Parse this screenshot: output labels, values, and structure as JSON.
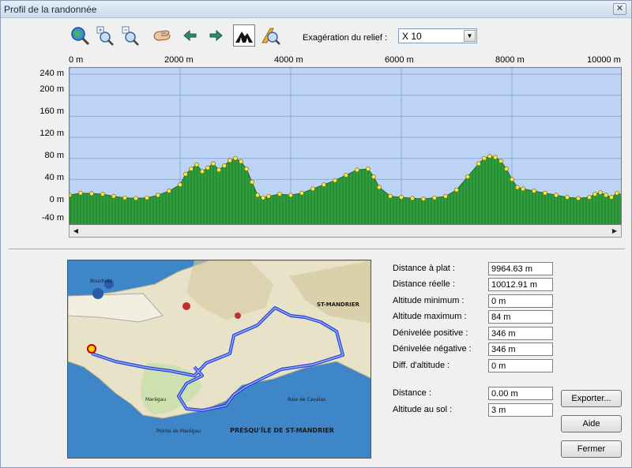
{
  "window": {
    "title": "Profil de la randonnée",
    "close_glyph": "✕"
  },
  "toolbar": {
    "buttons": [
      {
        "name": "zoom-extent-icon"
      },
      {
        "name": "zoom-in-icon"
      },
      {
        "name": "zoom-out-icon"
      },
      {
        "name": "pan-hand-icon"
      },
      {
        "name": "arrow-left-icon"
      },
      {
        "name": "arrow-right-icon"
      },
      {
        "name": "terrain-fill-icon",
        "active": true
      },
      {
        "name": "profile-search-icon"
      }
    ],
    "exaggeration_label": "Exagération du relief :",
    "exaggeration_value": "X 10"
  },
  "chart_data": {
    "type": "area",
    "xlabel": "",
    "ylabel": "",
    "xlim": [
      0,
      10000
    ],
    "ylim": [
      -40,
      240
    ],
    "x_ticks": [
      "0 m",
      "2000 m",
      "4000 m",
      "6000 m",
      "8000 m",
      "10000 m"
    ],
    "y_ticks": [
      "240 m",
      "200 m",
      "160 m",
      "120 m",
      "80 m",
      "40 m",
      "0 m",
      "-40 m"
    ],
    "y_tick_values": [
      240,
      200,
      160,
      120,
      80,
      40,
      0,
      -40
    ],
    "grid": true,
    "fill_color": "#2e9e3c",
    "background_color": "#bcd3f4",
    "point_color": "#f2e64a",
    "x": [
      0,
      200,
      400,
      600,
      800,
      1000,
      1200,
      1400,
      1600,
      1800,
      2000,
      2100,
      2200,
      2300,
      2400,
      2500,
      2600,
      2700,
      2800,
      2900,
      3000,
      3100,
      3200,
      3300,
      3400,
      3500,
      3600,
      3800,
      4000,
      4200,
      4400,
      4600,
      4800,
      5000,
      5200,
      5400,
      5500,
      5600,
      5800,
      6000,
      6200,
      6400,
      6600,
      6800,
      7000,
      7200,
      7400,
      7500,
      7600,
      7700,
      7800,
      7900,
      8000,
      8100,
      8200,
      8400,
      8600,
      8800,
      9000,
      9200,
      9400,
      9500,
      9600,
      9700,
      9800,
      9900,
      10000
    ],
    "values": [
      10,
      14,
      13,
      12,
      8,
      5,
      4,
      5,
      10,
      18,
      30,
      50,
      60,
      68,
      55,
      62,
      70,
      58,
      66,
      76,
      80,
      74,
      60,
      35,
      10,
      5,
      8,
      12,
      10,
      14,
      22,
      30,
      38,
      48,
      58,
      60,
      45,
      25,
      8,
      6,
      4,
      3,
      5,
      8,
      20,
      45,
      70,
      80,
      84,
      82,
      75,
      60,
      40,
      25,
      22,
      18,
      14,
      10,
      6,
      4,
      6,
      12,
      15,
      10,
      6,
      14,
      10
    ]
  },
  "stats": [
    {
      "label": "Distance à plat :",
      "value": "9964.63 m"
    },
    {
      "label": "Distance réelle :",
      "value": "10012.91 m"
    },
    {
      "label": "Altitude minimum :",
      "value": "0 m"
    },
    {
      "label": "Altitude maximum :",
      "value": "84 m"
    },
    {
      "label": "Dénivelée positive :",
      "value": "346 m"
    },
    {
      "label": "Dénivelée négative :",
      "value": "346 m"
    },
    {
      "label": "Diff. d'altitude :",
      "value": "0 m"
    }
  ],
  "cursor": [
    {
      "label": "Distance :",
      "value": "0.00 m"
    },
    {
      "label": "Altitude au sol :",
      "value": "3 m"
    }
  ],
  "buttons": {
    "export": "Exporter...",
    "help": "Aide",
    "close": "Fermer"
  },
  "map": {
    "labels": [
      "PRESQU'ÎLE DE ST-MANDRIER",
      "ST-MANDRIER",
      "Baie de Cavalas",
      "Pointe de Marégau",
      "Bouchots",
      "Marégau"
    ],
    "track_color": "#2a3fd6"
  }
}
